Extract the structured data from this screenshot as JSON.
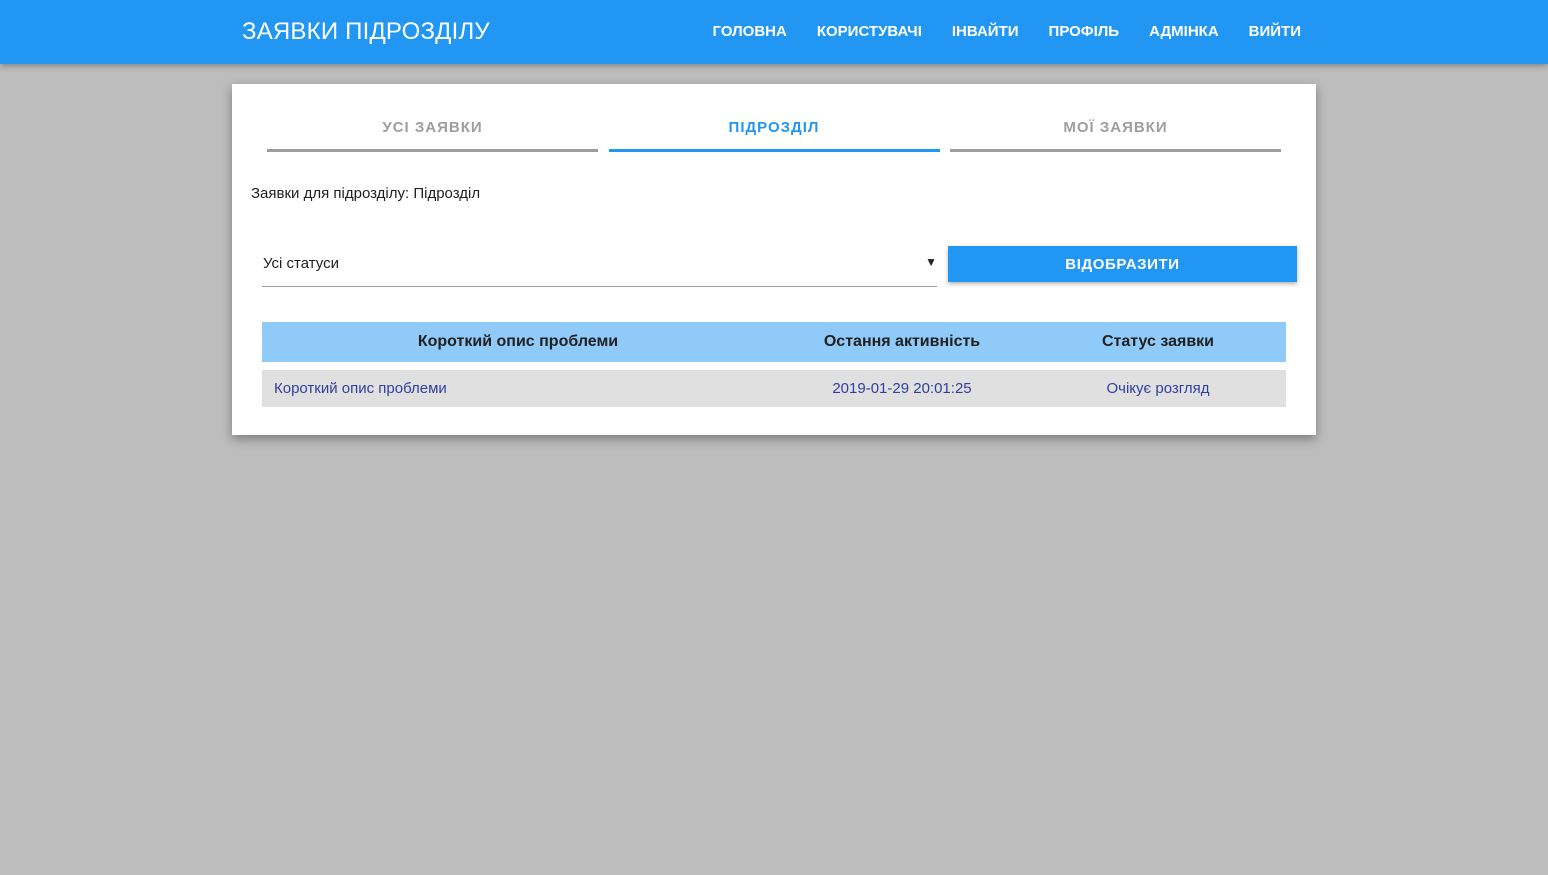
{
  "header": {
    "title": "ЗАЯВКИ ПІДРОЗДІЛУ",
    "nav": [
      "ГОЛОВНА",
      "КОРИСТУВАЧІ",
      "ІНВАЙТИ",
      "ПРОФІЛЬ",
      "АДМІНКА",
      "ВИЙТИ"
    ]
  },
  "tabs": [
    {
      "label": "УСІ ЗАЯВКИ",
      "active": false
    },
    {
      "label": "ПІДРОЗДІЛ",
      "active": true
    },
    {
      "label": "МОЇ ЗАЯВКИ",
      "active": false
    }
  ],
  "subtitle": "Заявки для підрозділу: Підрозділ",
  "filter": {
    "selected": "Усі статуси",
    "arrow": "▼",
    "button_label": "ВІДОБРАЗИТИ"
  },
  "table": {
    "headers": [
      "Короткий опис проблеми",
      "Остання активність",
      "Статус заявки"
    ],
    "rows": [
      [
        "Короткий опис проблеми",
        "2019-01-29 20:01:25",
        "Очікує розгляд"
      ]
    ]
  },
  "colors": {
    "primary": "#2196f3",
    "table_header": "#90caf9",
    "row_bg": "#e0e0e0",
    "link_text": "#303f9f",
    "background": "#bdbdbd"
  }
}
